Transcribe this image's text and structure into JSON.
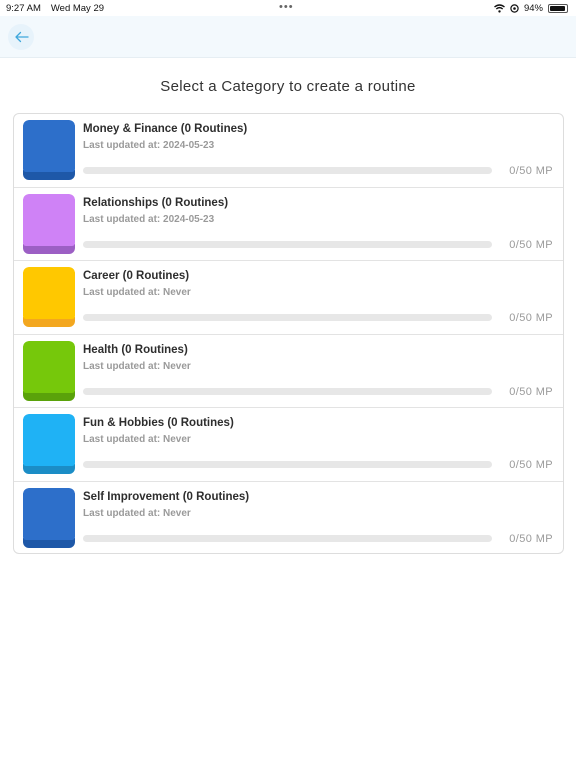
{
  "status": {
    "time": "9:27 AM",
    "date": "Wed May 29",
    "dots": "•••",
    "battery": "94%"
  },
  "header": {
    "back_icon": "arrow-left-icon"
  },
  "title": "Select a Category to create a routine",
  "colors": {
    "accent": "#3fa8dc"
  },
  "categories": [
    {
      "title": "Money & Finance (0 Routines)",
      "updated": "Last updated at: 2024-05-23",
      "mp": "0/50 MP",
      "progress": 0,
      "color": "#2d6fca",
      "shade": "#1e58a8"
    },
    {
      "title": "Relationships (0 Routines)",
      "updated": "Last updated at: 2024-05-23",
      "mp": "0/50 MP",
      "progress": 0,
      "color": "#cf82f6",
      "shade": "#9c5fc4"
    },
    {
      "title": "Career (0 Routines)",
      "updated": "Last updated at: Never",
      "mp": "0/50 MP",
      "progress": 0,
      "color": "#ffc800",
      "shade": "#f3a71f"
    },
    {
      "title": "Health (0 Routines)",
      "updated": "Last updated at: Never",
      "mp": "0/50 MP",
      "progress": 0,
      "color": "#76c80b",
      "shade": "#5aa20a"
    },
    {
      "title": "Fun & Hobbies (0 Routines)",
      "updated": "Last updated at: Never",
      "mp": "0/50 MP",
      "progress": 0,
      "color": "#1fb2f5",
      "shade": "#1b8dc6"
    },
    {
      "title": "Self Improvement (0 Routines)",
      "updated": "Last updated at: Never",
      "mp": "0/50 MP",
      "progress": 0,
      "color": "#2d6fca",
      "shade": "#1e58a8"
    }
  ]
}
